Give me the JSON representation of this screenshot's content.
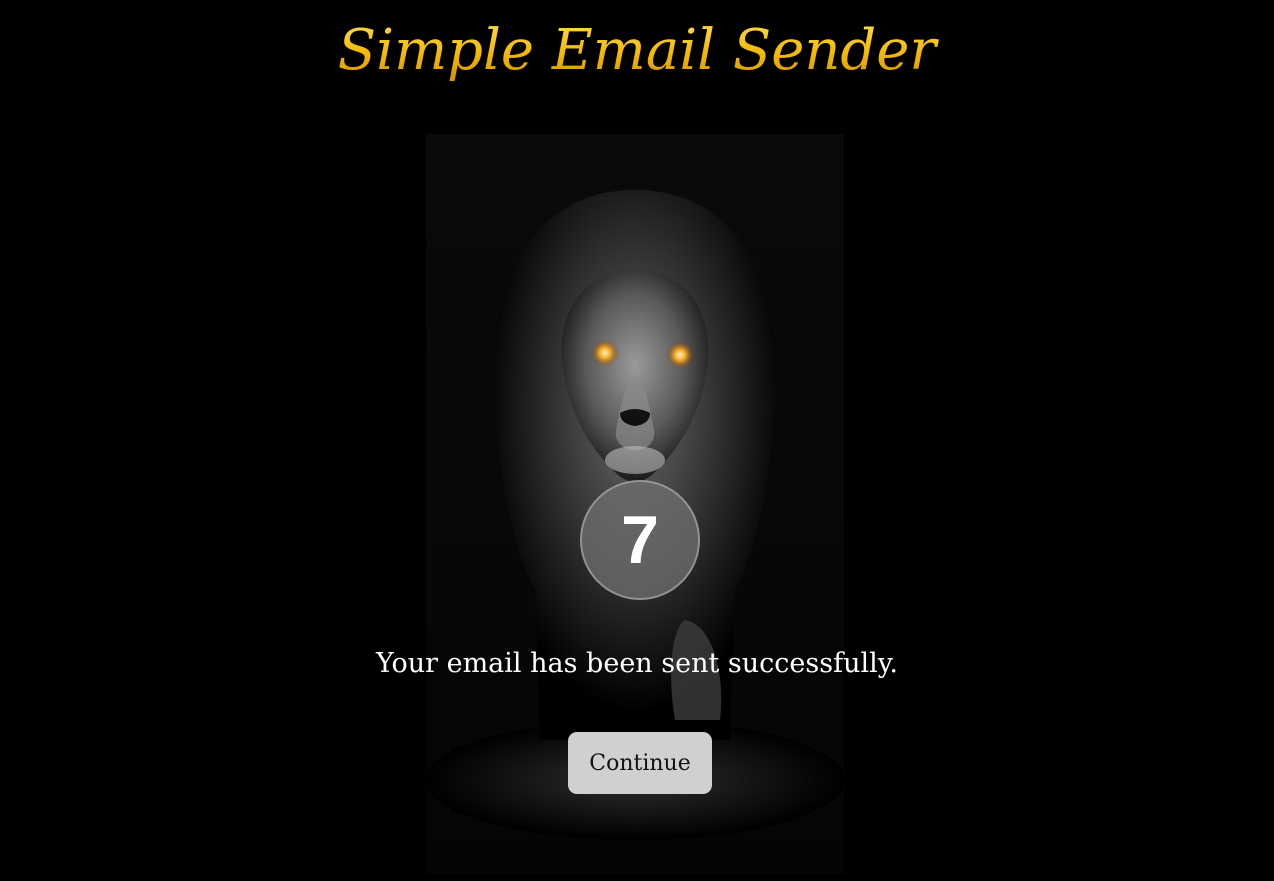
{
  "app": {
    "title": "Simple Email Sender"
  },
  "hero": {
    "image": "lion-photo"
  },
  "countdown": {
    "value": "7"
  },
  "status": {
    "message": "Your email has been sent successfully."
  },
  "actions": {
    "continue_label": "Continue"
  },
  "colors": {
    "background": "#000000",
    "title_gold": "#f2b705",
    "button_bg": "#d0d0d0",
    "counter_bg": "#6e6e6e"
  }
}
